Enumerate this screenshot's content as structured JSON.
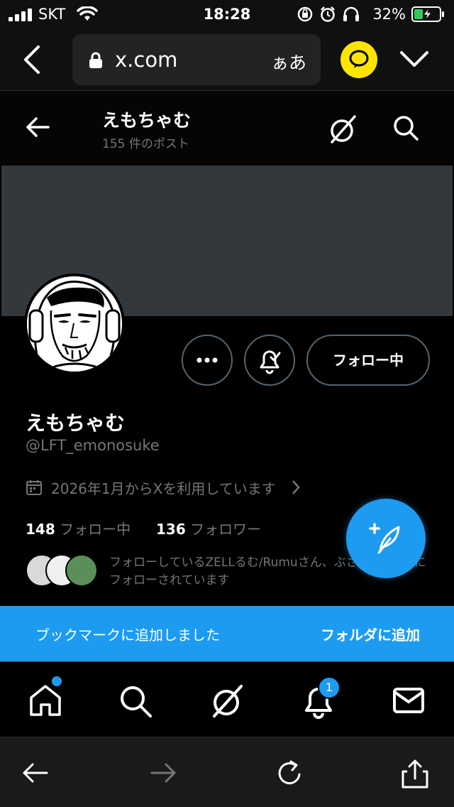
{
  "status_bar": {
    "carrier": "SKT",
    "time": "18:28",
    "battery": "32%"
  },
  "browser": {
    "url": "x.com",
    "text_size_button": "ぁあ"
  },
  "profile_header": {
    "name": "えもちゃむ",
    "post_count": "155 件のポスト"
  },
  "profile": {
    "display_name": "えもちゃむ",
    "handle": "@LFT_emonosuke",
    "joined": "2026年1月からXを利用しています",
    "following_count": "148",
    "following_label": "フォロー中",
    "followers_count": "136",
    "followers_label": "フォロワー",
    "followed_by": "フォローしているZELLるむ/Rumuさん、ぶさん、他3人にフォローされています"
  },
  "actions": {
    "follow_button": "フォロー中"
  },
  "toast": {
    "message": "ブックマークに追加しました",
    "action": "フォルダに追加"
  },
  "tab_bar": {
    "notification_count": "1"
  },
  "colors": {
    "accent": "#1d9bf0",
    "background": "#000000",
    "banner": "#33383d",
    "secondary_text": "#71767b"
  }
}
